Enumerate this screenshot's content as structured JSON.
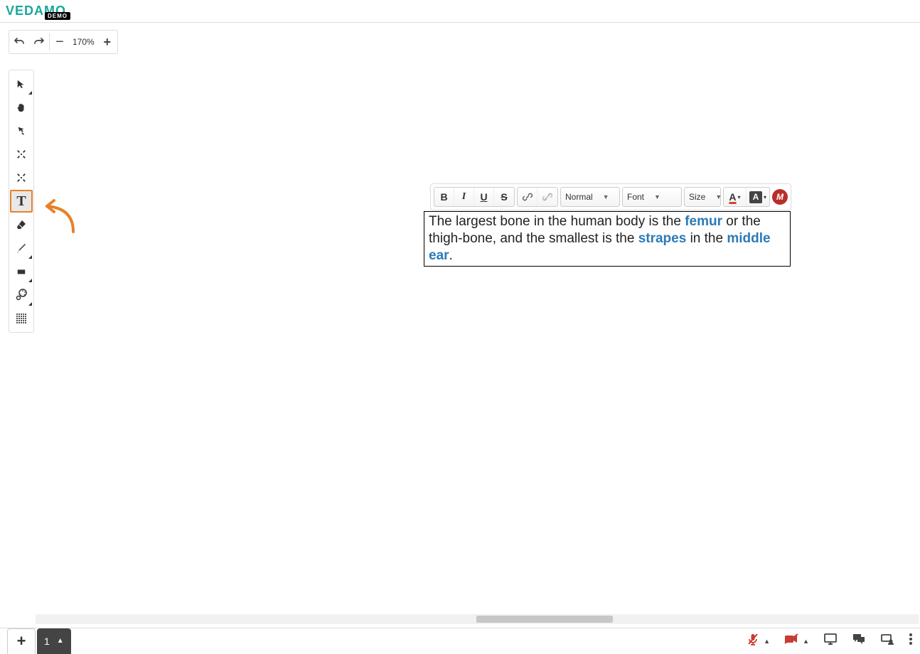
{
  "logo": {
    "text": "VEDAMO",
    "badge": "DEMO"
  },
  "zoom": {
    "percent": "170%"
  },
  "editor_toolbar": {
    "style_select": "Normal",
    "font_select": "Font",
    "size_select": "Size"
  },
  "textbox": {
    "p1a": "The largest  bone in the human body is the  ",
    "kw1": "femur",
    "p1b": " or the thigh-bone, and the smallest is the ",
    "kw2": "strapes",
    "p1c": " in the ",
    "kw3": "middle ear",
    "p1d": "."
  },
  "pages": {
    "current": "1"
  }
}
